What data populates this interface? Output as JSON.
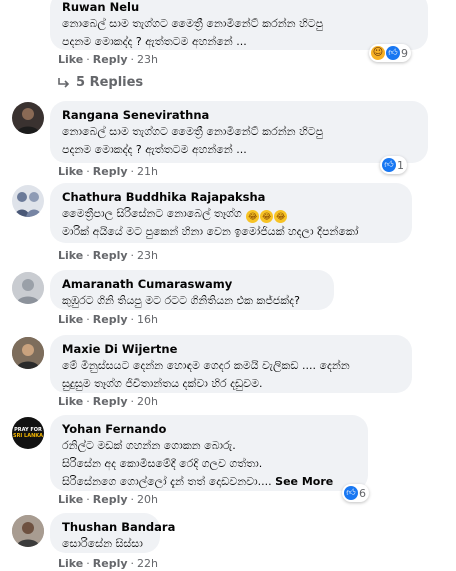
{
  "comments": [
    {
      "name": "Ruwan Nelu",
      "lines": [
        "නොබෙල් සාම තැග්ගට මෛත්‍රී නොමිනේට් කරන්න හිටපු",
        "පදනම මොකද්ද ? ඇත්තටම අහන්නේ ..."
      ],
      "like": "Like",
      "reply": "Reply",
      "time": "23h",
      "reaction_count": "9",
      "reaction_icons": [
        "haha-icon",
        "like-icon"
      ],
      "replies_label": "5 Replies"
    },
    {
      "name": "Rangana Senevirathna",
      "lines": [
        "නොබෙල් සාම තැග්ගට මෛත්‍රී නොමිනේට් කරන්න හිටපු",
        "පදනම මොකද්ද ? ඇත්තටම අහන්නේ ..."
      ],
      "like": "Like",
      "reply": "Reply",
      "time": "21h",
      "reaction_count": "1",
      "reaction_icons": [
        "like-icon"
      ]
    },
    {
      "name": "Chathura Buddhika Rajapaksha",
      "lines": [
        "මෛත්‍රීපාල සිරිසේනට නොබෙල් තෑග්ග",
        "මාරික් අයියේ මට පුකෙන් හිනා වෙන ඉමෝජියක් හදලා දීපන්කෝ"
      ],
      "line1_emojis": 3,
      "like": "Like",
      "reply": "Reply",
      "time": "23h"
    },
    {
      "name": "Amaranath Cumaraswamy",
      "lines": [
        "කුඹුරට ගිනි තියපු මට රටට ගිනිතියන එක කජ්ජක්ද?"
      ],
      "like": "Like",
      "reply": "Reply",
      "time": "16h"
    },
    {
      "name": "Maxie Di Wijertne",
      "lines": [
        "මේ මිනුස්සයට දෙන්න හොඳම ගෙදර කමයි වැලිකඩ .... දෙන්න",
        "සුදුසුම තෑග්ග ජිවිතාන්තය දක්වා හිර දඩුවම."
      ],
      "like": "Like",
      "reply": "Reply",
      "time": "20h"
    },
    {
      "name": "Yohan Fernando",
      "lines": [
        "රනිල්ට මඩක් ගහන්න ගොකන බොරු.",
        "සිරිසේන අද කොමිසමේදී රෙදි ගලව ගත්තා.",
        "සිරිසේනගෙ ගොල්ලෝ දැන් තත් දොඩවනවා...."
      ],
      "see_more": "See More",
      "like": "Like",
      "reply": "Reply",
      "time": "20h",
      "reaction_count": "6",
      "reaction_icons": [
        "like-icon"
      ],
      "avatar_text": [
        "PRAY FOR",
        "SRI LANKA"
      ]
    },
    {
      "name": "Thushan Bandara",
      "lines": [
        "සොරිසේන සිස්සා"
      ],
      "like": "Like",
      "reply": "Reply",
      "time": "22h"
    }
  ],
  "colors": {
    "bubble": "#f0f2f5",
    "meta_text": "#65676b",
    "like_blue": "#1877f2",
    "haha_yellow": "#f7b125"
  }
}
